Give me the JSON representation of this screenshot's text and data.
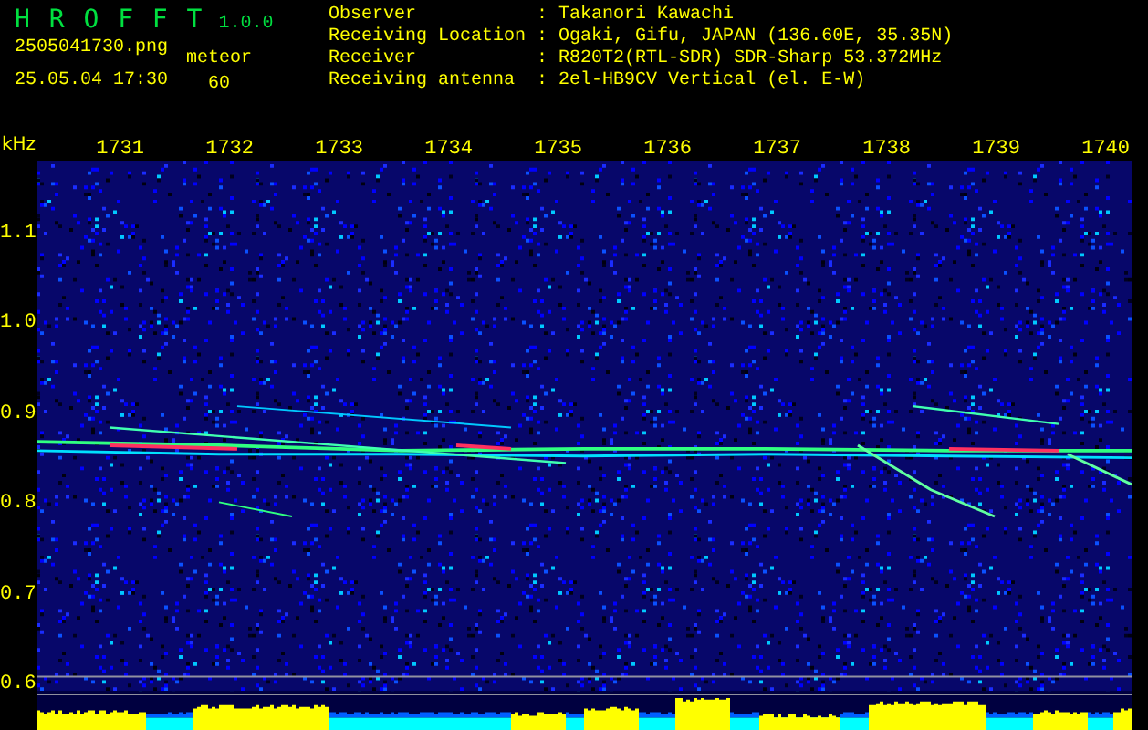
{
  "header": {
    "app_name": "H R O F F T",
    "version": "1.0.0",
    "file_name": "2505041730.png",
    "date_time": "25.05.04 17:30",
    "mode": "meteor",
    "count": "60"
  },
  "info": [
    {
      "label": "Observer",
      "separator": ":",
      "value": "Takanori Kawachi"
    },
    {
      "label": "Receiving Location",
      "separator": ":",
      "value": "Ogaki, Gifu, JAPAN (136.60E, 35.35N)"
    },
    {
      "label": "Receiver",
      "separator": ":",
      "value": "R820T2(RTL-SDR) SDR-Sharp 53.372MHz"
    },
    {
      "label": "Receiving antenna",
      "separator": ":",
      "value": "2el-HB9CV Vertical (el. E-W)"
    }
  ],
  "frequency_axis": {
    "unit": "kHz",
    "ticks": [
      "1.1",
      "1.0",
      "0.9",
      "0.8",
      "0.7",
      "0.6"
    ]
  },
  "time_axis": {
    "labels": [
      "1731",
      "1732",
      "1733",
      "1734",
      "1735",
      "1736",
      "1737",
      "1738",
      "1739",
      "1740"
    ]
  }
}
